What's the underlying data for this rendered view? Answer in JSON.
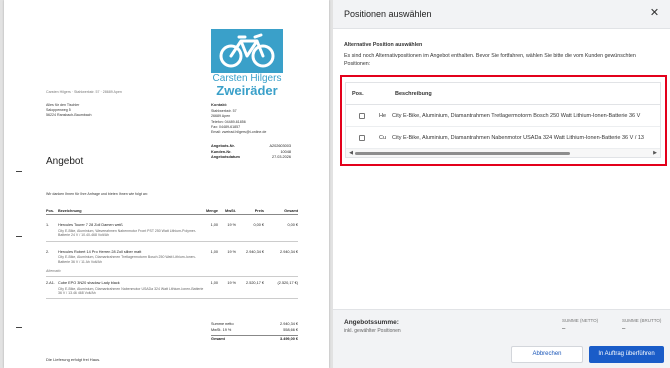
{
  "document": {
    "logo_name": "Carsten Hilgers",
    "logo_brand": "Zweiräder",
    "sender_line": "Carsten Hilgers · Stahlwerkstr. 57 · 28689 Apen",
    "recipient": [
      "Alles für den Tischler",
      "Saloppenweg 5",
      "56224 Ransbach-Baumbach"
    ],
    "contact_title": "Kontakt:",
    "contact": [
      "Stahlwerkstr. 57",
      "26689 Apen",
      "Telefon: 04489-61856",
      "Fax: 04489-61857",
      "Email: zweirad.hilgers@t-online.de"
    ],
    "meta": [
      {
        "label": "Angebots-Nr.",
        "value": "A202603003"
      },
      {
        "label": "Kunden-Nr.",
        "value": "10048"
      },
      {
        "label": "Angebotsdatum",
        "value": "27.03.2026"
      }
    ],
    "title": "Angebot",
    "greeting": "Wir danken Ihnen für Ihre Anfrage und bieten Ihnen wie folgt an:",
    "table_headers": {
      "pos": "Pos.",
      "desc": "Bezeichnung",
      "menge": "Menge",
      "mwst": "MwSt.",
      "preis": "Preis",
      "gesamt": "Gesamt"
    },
    "items": [
      {
        "pos": "1.",
        "name": "Hercules Tourer 7 28 Zoll Damen weiß",
        "desc": "City E-Bike, Aluminium, Waveeahmen Nabenmotor Front PST 250 Watt Lithium-Polymer-Batterie 24 V / 10.40-468 Volt/Ah",
        "menge": "1,00",
        "mwst": "19 %",
        "preis": "0,00 €",
        "gesamt": "0,00 €"
      },
      {
        "pos": "2.",
        "name": "Hercules Robert 14 Pro Herren 28 Zoll silber matt",
        "desc": "City E-Bike, Aluminium, Diamantrahmen Tretlagermotorm Bosch 250 Watt Lithium-Ionen-Batterie 36 V / 11 Ah Volt/Ah",
        "menge": "1,00",
        "mwst": "19 %",
        "preis": "2.940,34 €",
        "gesamt": "2.940,34 €"
      },
      {
        "pos": "2.A1.",
        "name": "Cube EPO 3N20 shadow Lady black",
        "desc": "City E-Bike, Aluminium, Diamantrahmen Nabenmotor USADa 324 Watt Lithium-Ionen-Batterie 36 V / 13.46 468 Volt/Ah",
        "menge": "1,00",
        "mwst": "19 %",
        "preis": "2.520,17 €",
        "gesamt": "(2.520,17 €)"
      }
    ],
    "alt_label": "Alternativ",
    "totals": [
      {
        "label": "Summe netto",
        "value": "2.940,34 €"
      },
      {
        "label": "MwSt. 19 %",
        "value": "558,66 €"
      },
      {
        "label": "Gesamt",
        "value": "3.499,00 €"
      }
    ],
    "footer_note": "Die Lieferung erfolgt frei Haus."
  },
  "panel": {
    "title": "Positionen auswählen",
    "section_title": "Alternative Position auswählen",
    "section_info": "Es sind noch Alternativpositionen im Angebot enthalten. Bevor Sie fortfahren, wählen Sie bitte die vom Kunden gewünschten Positionen:",
    "col_pos": "Pos.",
    "col_desc": "Beschreibung",
    "rows": [
      {
        "code": "He",
        "desc": "City E-Bike, Aluminium, Diamantrahmen Tretlagermotorm Bosch 250 Watt Lithium-Ionen-Batterie 36 V"
      },
      {
        "code": "Cu",
        "desc": "City E-Bike, Aluminium, Diamantrahmen Nabenmotor USADa 324 Watt Lithium-Ionen-Batterie 36 V / 13"
      }
    ],
    "footer": {
      "sum_label": "Angebotssumme:",
      "sum_sub": "inkl. gewählter Positionen",
      "netto_label": "SUMME (NETTO)",
      "netto_value": "–",
      "brutto_label": "SUMME (BRUTTO)",
      "brutto_value": "–",
      "cancel": "Abbrechen",
      "apply": "In Auftrag überführen"
    }
  },
  "colors": {
    "accent": "#1a5cc8",
    "logo": "#3aa0c9",
    "highlight": "#e3001b"
  }
}
